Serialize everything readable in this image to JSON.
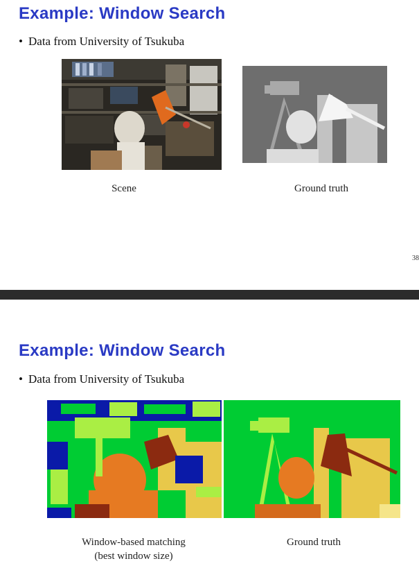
{
  "slide1": {
    "title": "Example: Window Search",
    "bullet": "Data from University of Tsukuba",
    "caption_left": "Scene",
    "caption_right": "Ground truth",
    "page_number": "38"
  },
  "slide2": {
    "title": "Example: Window Search",
    "bullet": "Data from University of Tsukuba",
    "caption_left_line1": "Window-based matching",
    "caption_left_line2": "(best window size)",
    "caption_right": "Ground truth"
  },
  "colors": {
    "title": "#2a3ac4",
    "divider": "#2b2b2b",
    "disparity_green": "#00cc33",
    "disparity_lime": "#aaee44",
    "disparity_orange": "#e67a22",
    "disparity_brown": "#8b2a10",
    "disparity_yellow": "#e8c84a",
    "disparity_blue": "#0a1aa8"
  }
}
